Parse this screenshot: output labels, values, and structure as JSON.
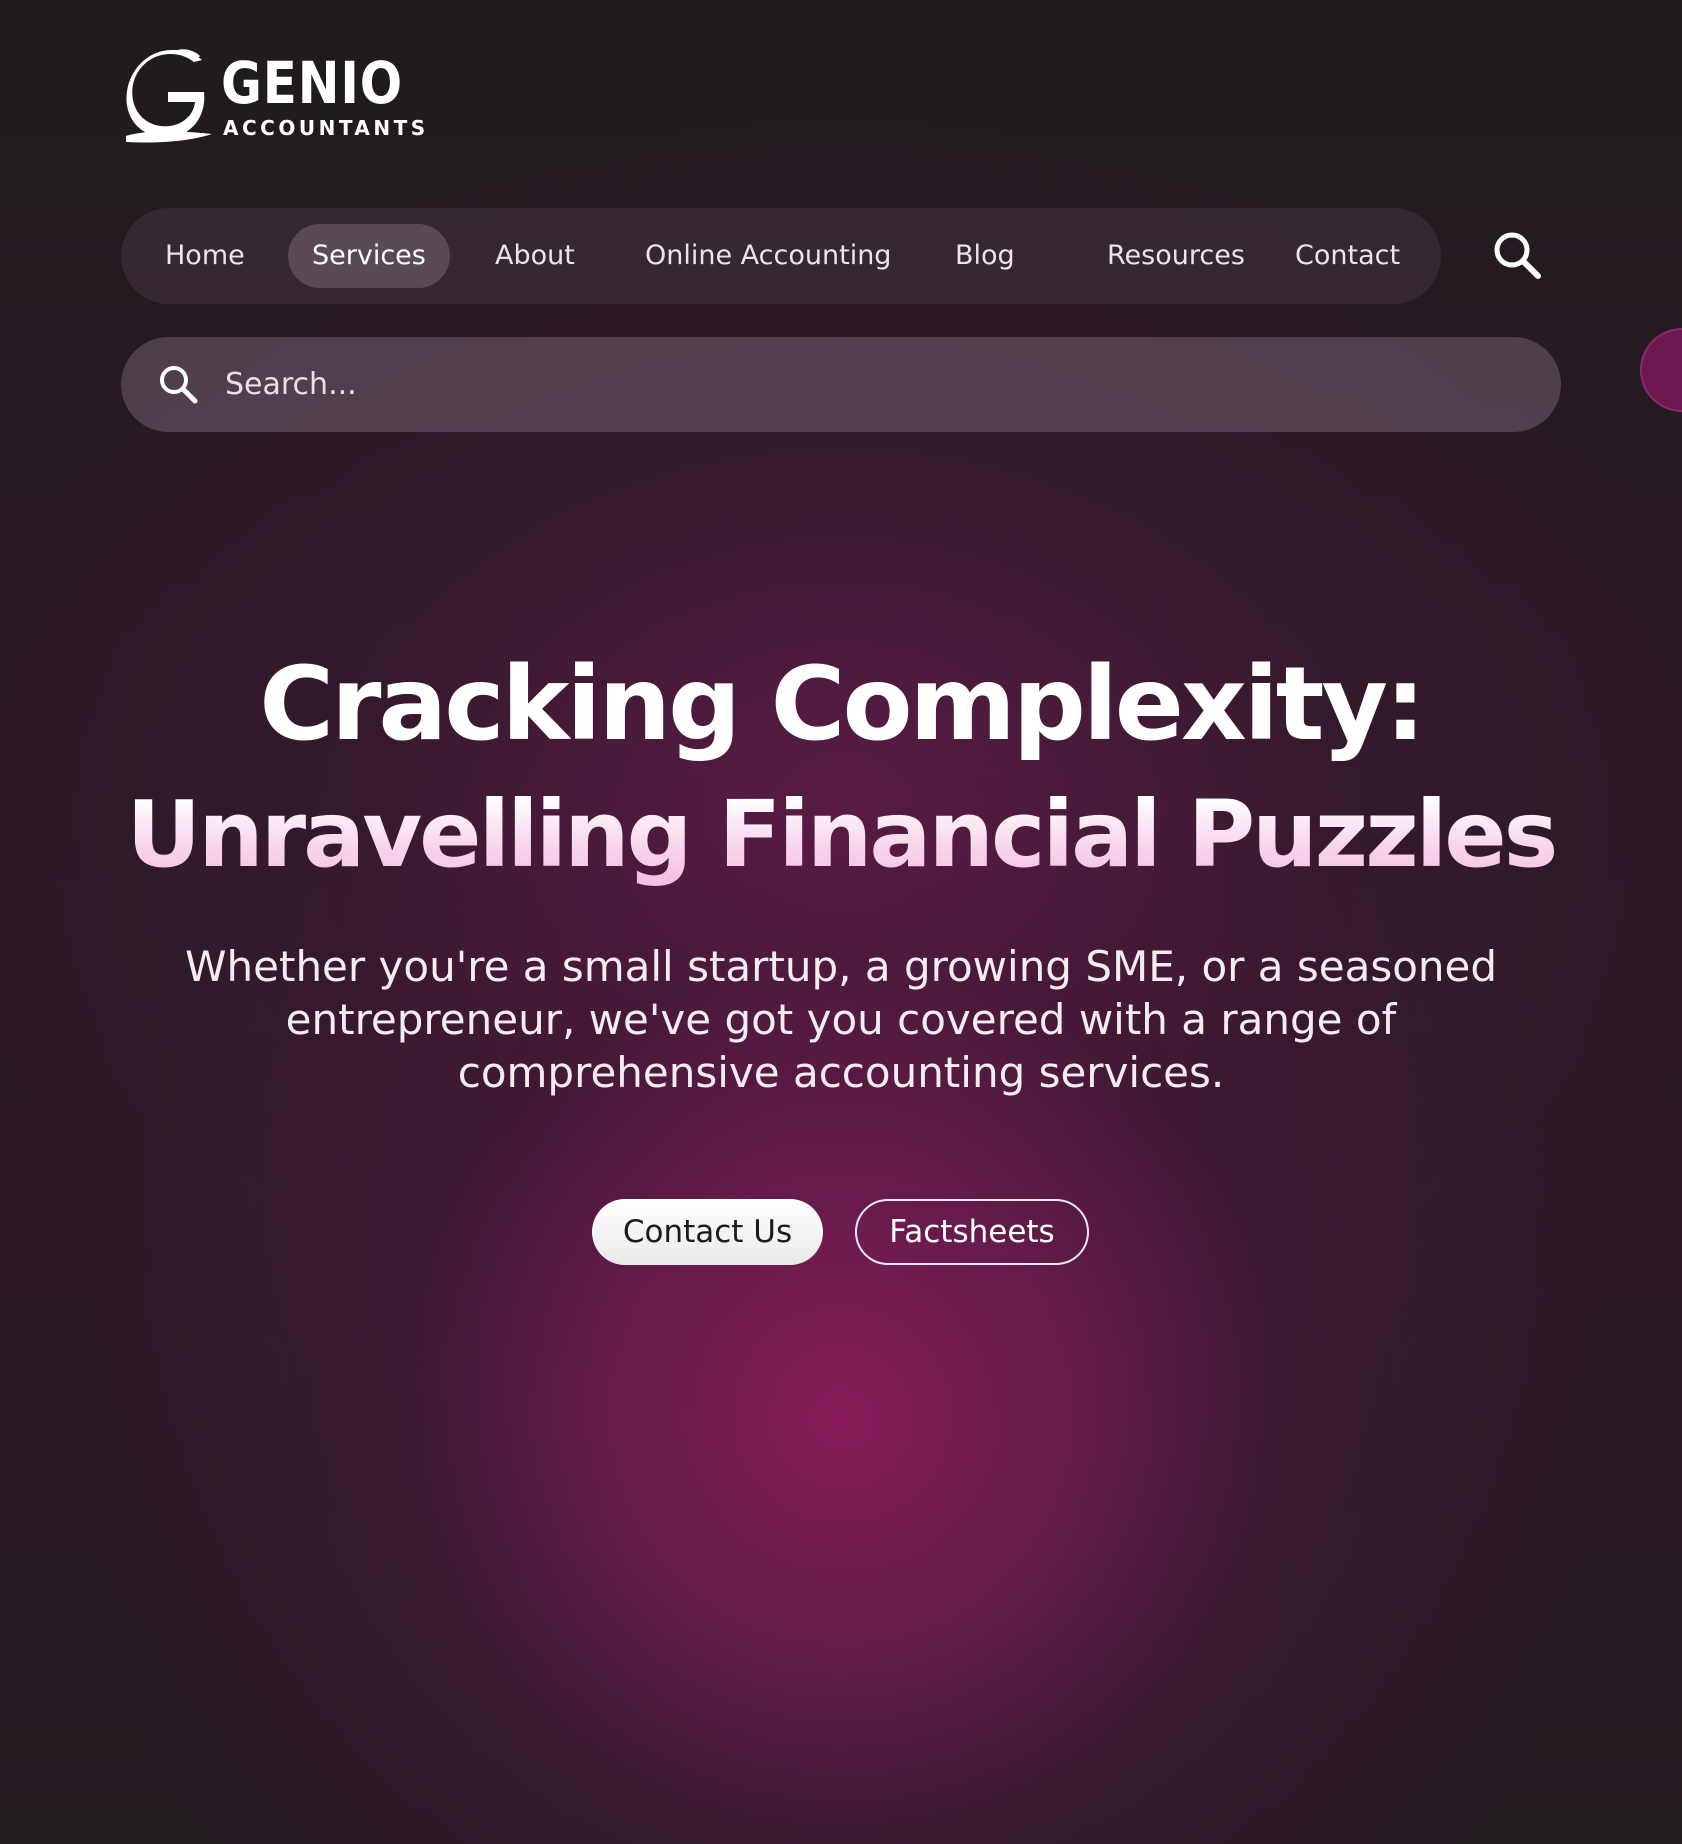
{
  "brand": {
    "name": "GENIO",
    "tagline": "ACCOUNTANTS"
  },
  "nav": {
    "items": [
      {
        "label": "Home",
        "active": false
      },
      {
        "label": "Services",
        "active": true
      },
      {
        "label": "About",
        "active": false
      },
      {
        "label": "Online Accounting",
        "active": false
      },
      {
        "label": "Blog",
        "active": false
      },
      {
        "label": "Resources",
        "active": false
      },
      {
        "label": "Contact",
        "active": false
      }
    ],
    "search_icon": "search-icon"
  },
  "search": {
    "placeholder": "Search...",
    "value": "",
    "icon": "search-icon"
  },
  "hero": {
    "title": "Cracking Complexity:",
    "subtitle": "Unravelling Financial Puzzles",
    "description": "Whether you're a small startup, a growing SME, or a seasoned entrepreneur, we've got you covered with a range of comprehensive accounting services.",
    "primary_button": "Contact Us",
    "secondary_button": "Factsheets"
  },
  "colors": {
    "background": "#1f1b1e",
    "accent": "#7a1c56",
    "nav_bg": "#3c2e38",
    "subtitle_tint": "#f8d6ec"
  }
}
